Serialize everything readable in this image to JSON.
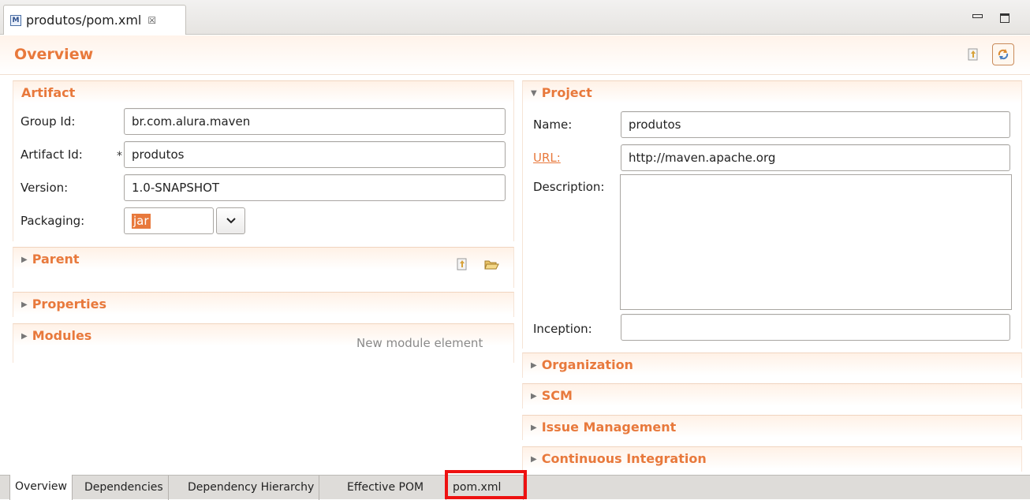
{
  "editor_tab": {
    "icon_letter": "M",
    "title": "produtos/pom.xml",
    "close_glyph": "☒"
  },
  "header": {
    "title": "Overview"
  },
  "artifact": {
    "title": "Artifact",
    "group_id_label": "Group Id:",
    "group_id_value": "br.com.alura.maven",
    "artifact_id_label": "Artifact Id:",
    "artifact_id_value": "produtos",
    "required_marker": "*",
    "version_label": "Version:",
    "version_value": "1.0-SNAPSHOT",
    "packaging_label": "Packaging:",
    "packaging_value": "jar"
  },
  "parent": {
    "title": "Parent"
  },
  "properties": {
    "title": "Properties"
  },
  "modules": {
    "title": "Modules",
    "hint": "New module element"
  },
  "project": {
    "title": "Project",
    "name_label": "Name:",
    "name_value": "produtos",
    "url_label": "URL:",
    "url_value": "http://maven.apache.org",
    "description_label": "Description:",
    "description_value": "",
    "inception_label": "Inception:",
    "inception_value": ""
  },
  "collapsed_sections": {
    "organization": "Organization",
    "scm": "SCM",
    "issue_management": "Issue Management",
    "continuous_integration": "Continuous Integration"
  },
  "bottom_tabs": {
    "overview": "Overview",
    "dependencies": "Dependencies",
    "dependency_hierarchy": "Dependency Hierarchy",
    "effective_pom": "Effective POM",
    "pom_xml": "pom.xml"
  },
  "icons": {
    "collapsed_twisty": "triangle-right-icon",
    "expanded_twisty": "triangle-down-icon",
    "highlight_color": "#ee1111",
    "accent_color": "#e8793c"
  }
}
